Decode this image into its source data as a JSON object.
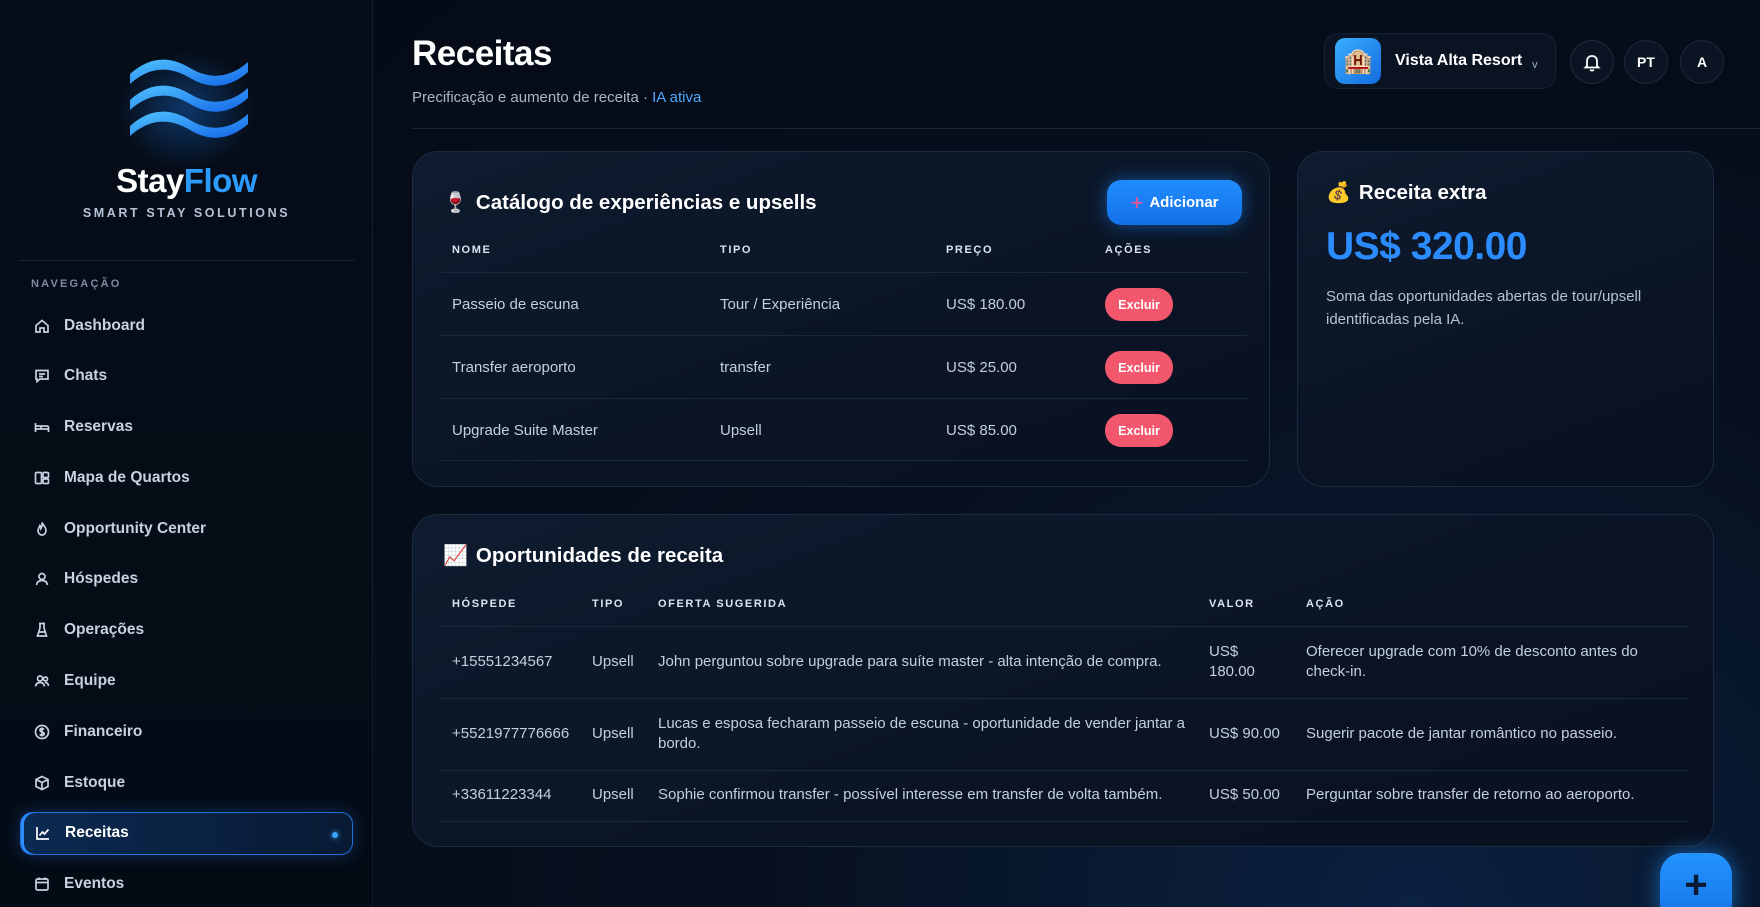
{
  "brand": {
    "name_part1": "Stay",
    "name_part2": "Flow",
    "tagline": "SMART STAY SOLUTIONS",
    "logo_icon": "wave-logo-icon"
  },
  "sidebar": {
    "heading": "NAVEGAÇÃO",
    "items": [
      {
        "label": "Dashboard",
        "icon": "home-icon"
      },
      {
        "label": "Chats",
        "icon": "chat-icon"
      },
      {
        "label": "Reservas",
        "icon": "bed-icon"
      },
      {
        "label": "Mapa de Quartos",
        "icon": "grid-icon"
      },
      {
        "label": "Opportunity Center",
        "icon": "flame-icon"
      },
      {
        "label": "Hóspedes",
        "icon": "user-icon"
      },
      {
        "label": "Operações",
        "icon": "flask-icon"
      },
      {
        "label": "Equipe",
        "icon": "team-icon"
      },
      {
        "label": "Financeiro",
        "icon": "dollar-icon"
      },
      {
        "label": "Estoque",
        "icon": "box-icon"
      },
      {
        "label": "Receitas",
        "icon": "chart-icon",
        "active": true
      },
      {
        "label": "Eventos",
        "icon": "calendar-icon"
      }
    ]
  },
  "header": {
    "title": "Receitas",
    "subtitle": "Precificação e aumento de receita · ",
    "ai_status": "IA ativa",
    "resort_name": "Vista Alta Resort",
    "resort_icon": "🏨",
    "caret": "v",
    "lang": "PT",
    "avatar": "A"
  },
  "catalog": {
    "emoji": "🍷",
    "title": "Catálogo de experiências e upsells",
    "add_label": "Adicionar",
    "columns": [
      "NOME",
      "TIPO",
      "PREÇO",
      "AÇÕES"
    ],
    "rows": [
      {
        "name": "Passeio de escuna",
        "type": "Tour / Experiência",
        "price": "US$ 180.00",
        "action": "Excluir"
      },
      {
        "name": "Transfer aeroporto",
        "type": "transfer",
        "price": "US$ 25.00",
        "action": "Excluir"
      },
      {
        "name": "Upgrade Suite Master",
        "type": "Upsell",
        "price": "US$ 85.00",
        "action": "Excluir"
      }
    ]
  },
  "extra_revenue": {
    "emoji": "💰",
    "title": "Receita extra",
    "value": "US$ 320.00",
    "description": "Soma das oportunidades abertas de tour/upsell identificadas pela IA."
  },
  "opportunities": {
    "emoji": "📈",
    "title": "Oportunidades de receita",
    "columns": [
      "HÓSPEDE",
      "TIPO",
      "OFERTA SUGERIDA",
      "VALOR",
      "AÇÃO"
    ],
    "rows": [
      {
        "guest": "+15551234567",
        "type": "Upsell",
        "offer": "John perguntou sobre upgrade para suíte master - alta intenção de compra.",
        "value_1": "US$",
        "value_2": "180.00",
        "action": "Oferecer upgrade com 10% de desconto antes do check-in."
      },
      {
        "guest": "+5521977776666",
        "type": "Upsell",
        "offer": "Lucas e esposa fecharam passeio de escuna - oportunidade de vender jantar a bordo.",
        "value_1": "US$ 90.00",
        "value_2": "",
        "action": "Sugerir pacote de jantar romântico no passeio."
      },
      {
        "guest": "+33611223344",
        "type": "Upsell",
        "offer": "Sophie confirmou transfer - possível interesse em transfer de volta também.",
        "value_1": "US$ 50.00",
        "value_2": "",
        "action": "Perguntar sobre transfer de retorno ao aeroporto."
      }
    ]
  },
  "fab": {
    "label": "+"
  },
  "colors": {
    "accent": "#2a8cff",
    "danger": "#f2576e",
    "background": "#050b16"
  }
}
